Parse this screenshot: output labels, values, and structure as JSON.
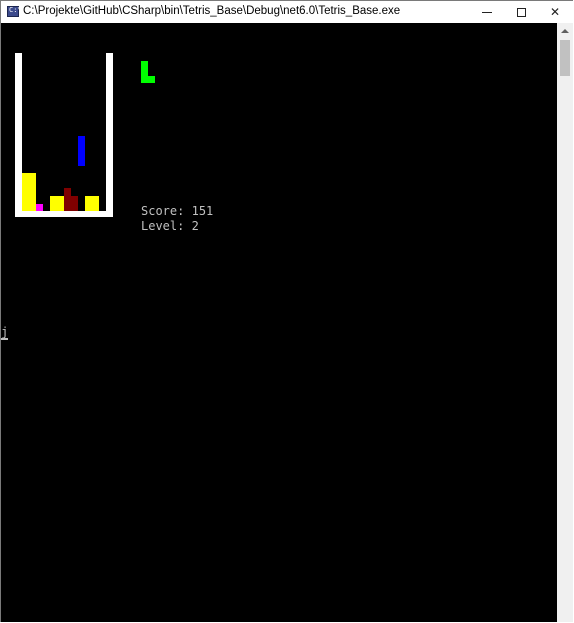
{
  "window": {
    "title": "C:\\Projekte\\GitHub\\CSharp\\bin\\Tetris_Base\\Debug\\net6.0\\Tetris_Base.exe",
    "icon": "console-app-icon",
    "icon_glyph": "C:\\",
    "controls": {
      "minimize": "minimize-icon",
      "maximize": "maximize-icon",
      "close_label": "✕"
    }
  },
  "game": {
    "score_label": "Score:",
    "score": "151",
    "level_label": "Level:",
    "level": "2",
    "colors": {
      "background": "#000000",
      "well": "#ffffff",
      "yellow": "#ffff00",
      "magenta": "#ff00ff",
      "dark_red": "#800000",
      "blue": "#0000ff",
      "green": "#00ff00"
    },
    "next_piece": {
      "shape": "L",
      "color": "#00ff00"
    },
    "falling_piece": {
      "shape": "I",
      "color": "#0000ff",
      "orientation": "vertical"
    }
  },
  "console": {
    "cursor_char": "j"
  }
}
